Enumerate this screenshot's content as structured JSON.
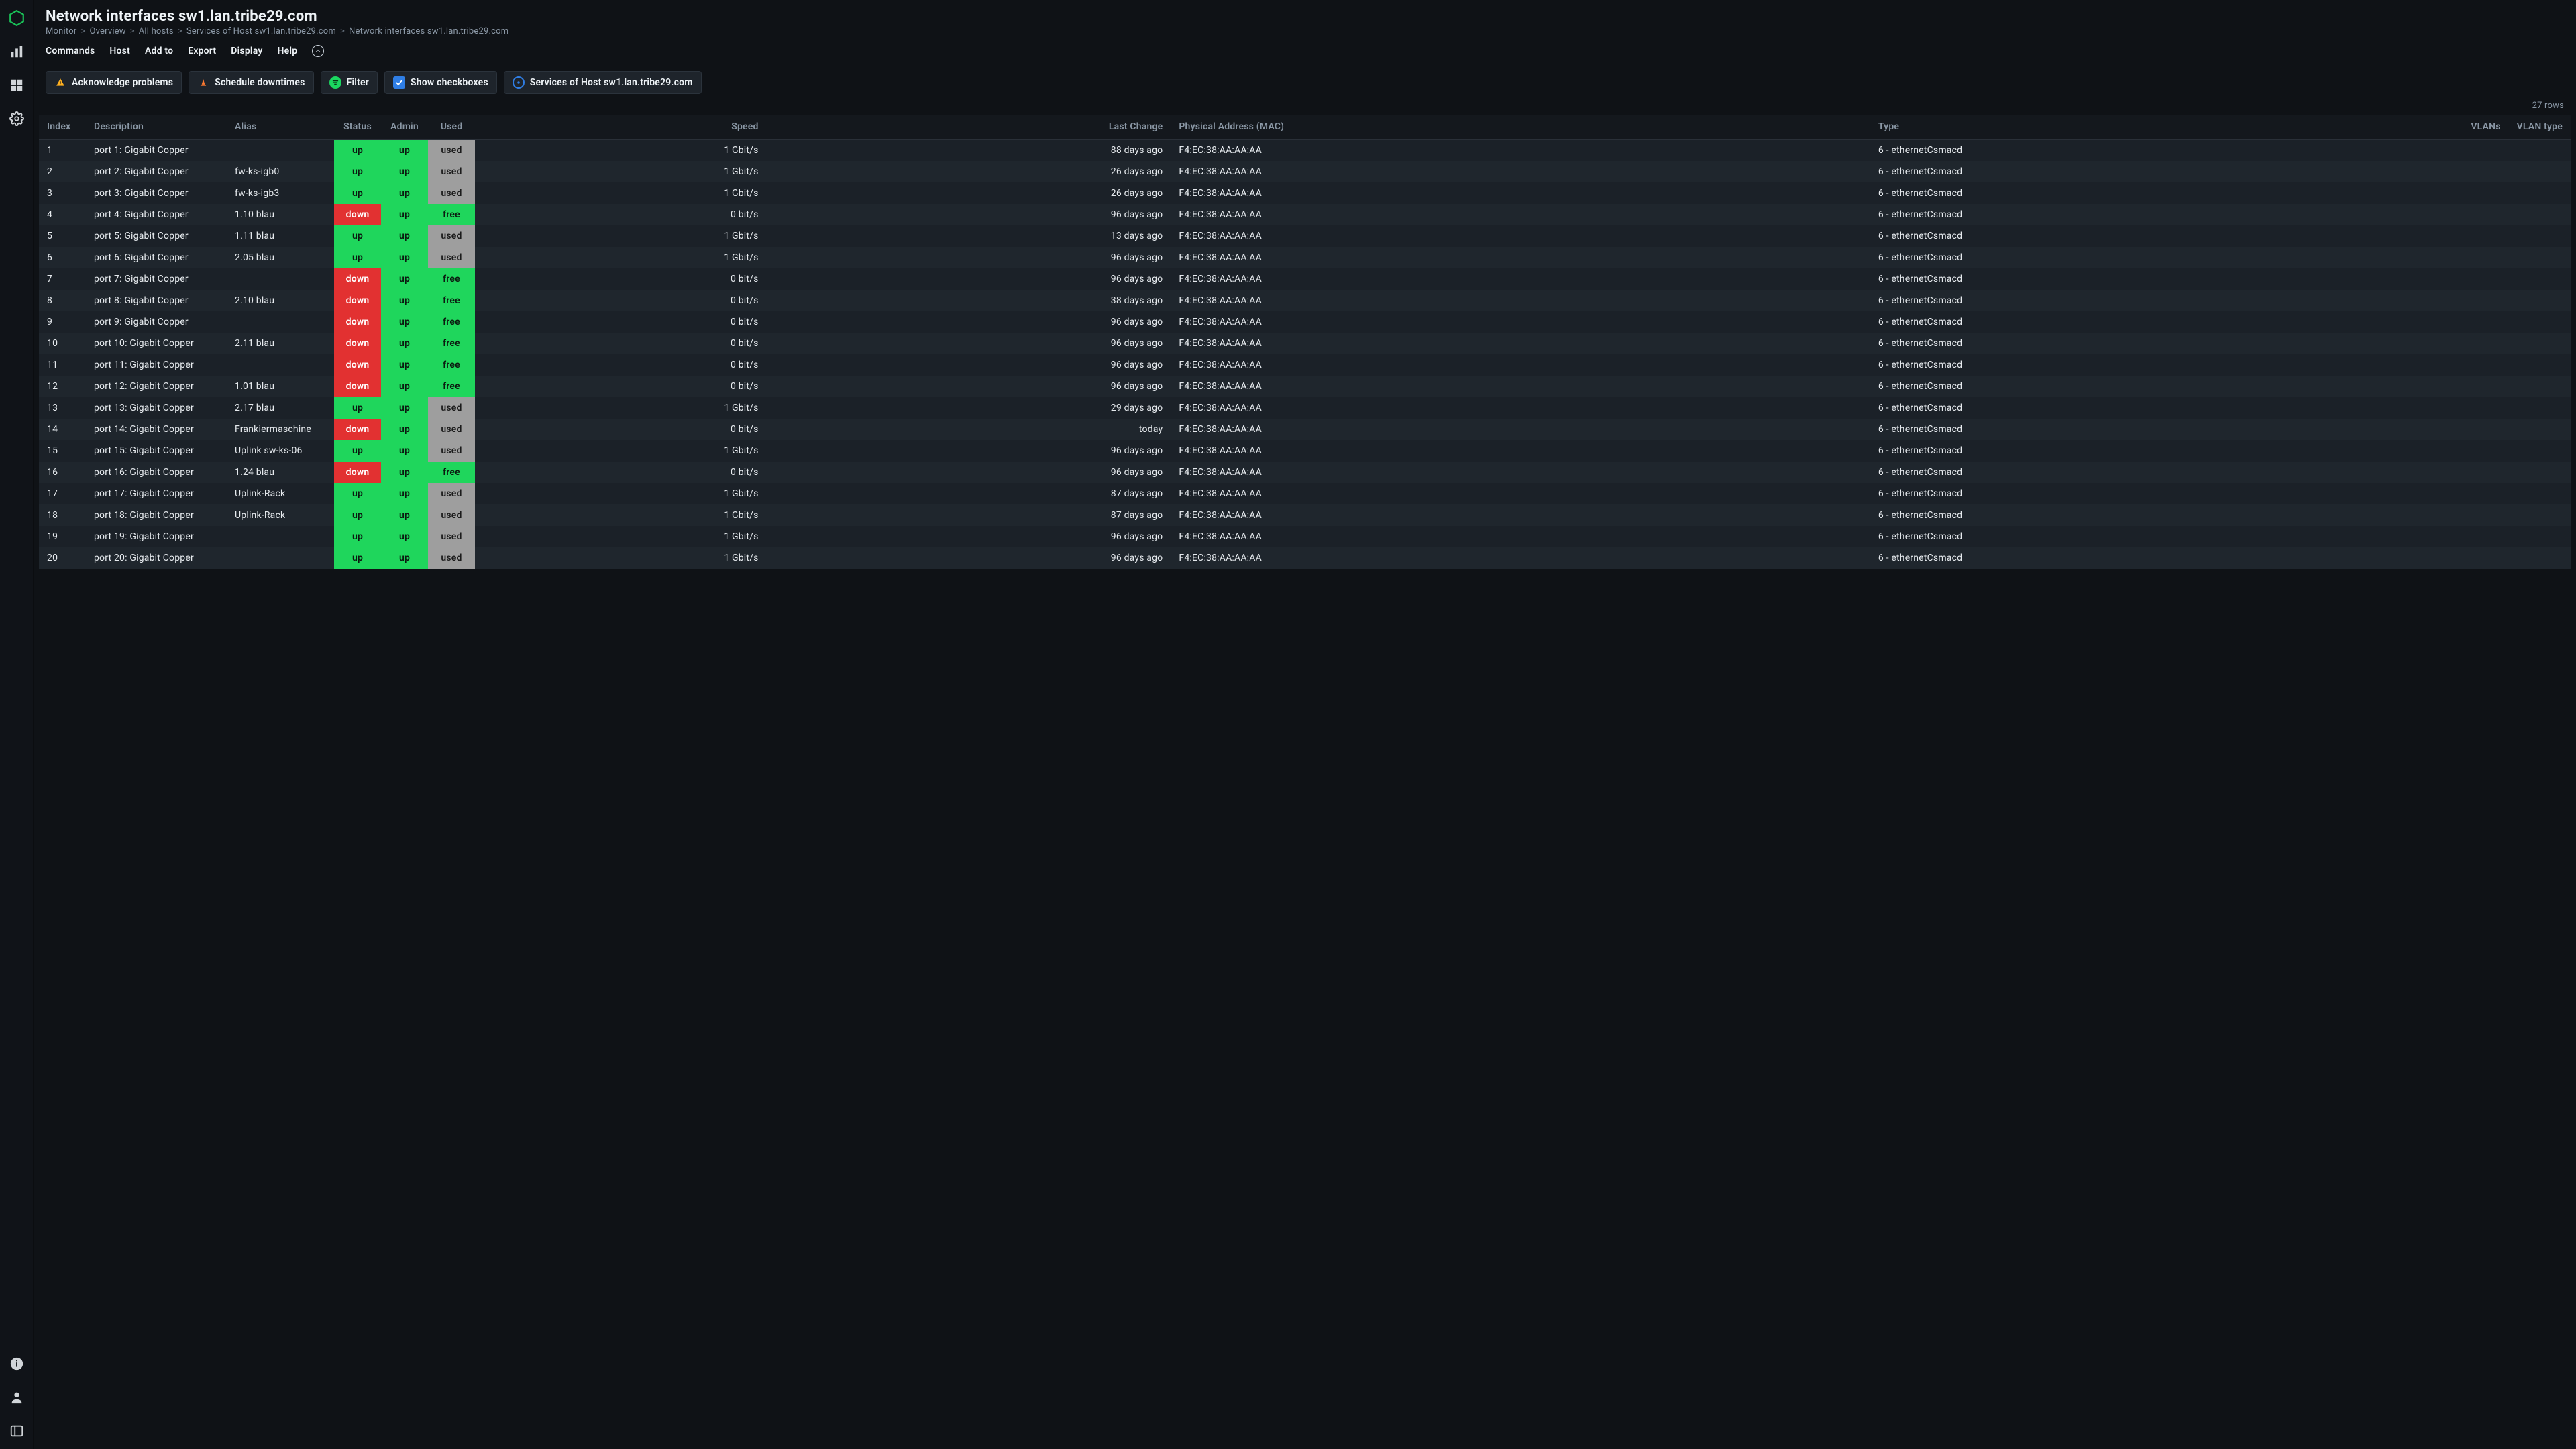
{
  "page": {
    "title": "Network interfaces sw1.lan.tribe29.com",
    "rows_label": "27 rows"
  },
  "breadcrumb": [
    "Monitor",
    "Overview",
    "All hosts",
    "Services of Host sw1.lan.tribe29.com",
    "Network interfaces sw1.lan.tribe29.com"
  ],
  "menubar": [
    "Commands",
    "Host",
    "Add to",
    "Export",
    "Display",
    "Help"
  ],
  "toolbar": {
    "ack": "Acknowledge problems",
    "downtime": "Schedule downtimes",
    "filter": "Filter",
    "checkboxes": "Show checkboxes",
    "services": "Services of Host sw1.lan.tribe29.com"
  },
  "columns": {
    "index": "Index",
    "description": "Description",
    "alias": "Alias",
    "status": "Status",
    "admin": "Admin",
    "used": "Used",
    "speed": "Speed",
    "last": "Last Change",
    "mac": "Physical Address (MAC)",
    "type": "Type",
    "vlans": "VLANs",
    "vtype": "VLAN type"
  },
  "rows": [
    {
      "index": "1",
      "desc": "port 1: Gigabit Copper",
      "alias": "",
      "status": "up",
      "admin": "up",
      "used": "used",
      "speed": "1 Gbit/s",
      "last": "88 days ago",
      "mac": "F4:EC:38:AA:AA:AA",
      "type": "6 - ethernetCsmacd",
      "vlans": "",
      "vtype": ""
    },
    {
      "index": "2",
      "desc": "port 2: Gigabit Copper",
      "alias": "fw-ks-igb0",
      "status": "up",
      "admin": "up",
      "used": "used",
      "speed": "1 Gbit/s",
      "last": "26 days ago",
      "mac": "F4:EC:38:AA:AA:AA",
      "type": "6 - ethernetCsmacd",
      "vlans": "",
      "vtype": ""
    },
    {
      "index": "3",
      "desc": "port 3: Gigabit Copper",
      "alias": "fw-ks-igb3",
      "status": "up",
      "admin": "up",
      "used": "used",
      "speed": "1 Gbit/s",
      "last": "26 days ago",
      "mac": "F4:EC:38:AA:AA:AA",
      "type": "6 - ethernetCsmacd",
      "vlans": "",
      "vtype": ""
    },
    {
      "index": "4",
      "desc": "port 4: Gigabit Copper",
      "alias": "1.10 blau",
      "status": "down",
      "admin": "up",
      "used": "free",
      "speed": "0 bit/s",
      "last": "96 days ago",
      "mac": "F4:EC:38:AA:AA:AA",
      "type": "6 - ethernetCsmacd",
      "vlans": "",
      "vtype": ""
    },
    {
      "index": "5",
      "desc": "port 5: Gigabit Copper",
      "alias": "1.11 blau",
      "status": "up",
      "admin": "up",
      "used": "used",
      "speed": "1 Gbit/s",
      "last": "13 days ago",
      "mac": "F4:EC:38:AA:AA:AA",
      "type": "6 - ethernetCsmacd",
      "vlans": "",
      "vtype": ""
    },
    {
      "index": "6",
      "desc": "port 6: Gigabit Copper",
      "alias": "2.05 blau",
      "status": "up",
      "admin": "up",
      "used": "used",
      "speed": "1 Gbit/s",
      "last": "96 days ago",
      "mac": "F4:EC:38:AA:AA:AA",
      "type": "6 - ethernetCsmacd",
      "vlans": "",
      "vtype": ""
    },
    {
      "index": "7",
      "desc": "port 7: Gigabit Copper",
      "alias": "",
      "status": "down",
      "admin": "up",
      "used": "free",
      "speed": "0 bit/s",
      "last": "96 days ago",
      "mac": "F4:EC:38:AA:AA:AA",
      "type": "6 - ethernetCsmacd",
      "vlans": "",
      "vtype": ""
    },
    {
      "index": "8",
      "desc": "port 8: Gigabit Copper",
      "alias": "2.10 blau",
      "status": "down",
      "admin": "up",
      "used": "free",
      "speed": "0 bit/s",
      "last": "38 days ago",
      "mac": "F4:EC:38:AA:AA:AA",
      "type": "6 - ethernetCsmacd",
      "vlans": "",
      "vtype": ""
    },
    {
      "index": "9",
      "desc": "port 9: Gigabit Copper",
      "alias": "",
      "status": "down",
      "admin": "up",
      "used": "free",
      "speed": "0 bit/s",
      "last": "96 days ago",
      "mac": "F4:EC:38:AA:AA:AA",
      "type": "6 - ethernetCsmacd",
      "vlans": "",
      "vtype": ""
    },
    {
      "index": "10",
      "desc": "port 10: Gigabit Copper",
      "alias": "2.11 blau",
      "status": "down",
      "admin": "up",
      "used": "free",
      "speed": "0 bit/s",
      "last": "96 days ago",
      "mac": "F4:EC:38:AA:AA:AA",
      "type": "6 - ethernetCsmacd",
      "vlans": "",
      "vtype": ""
    },
    {
      "index": "11",
      "desc": "port 11: Gigabit Copper",
      "alias": "",
      "status": "down",
      "admin": "up",
      "used": "free",
      "speed": "0 bit/s",
      "last": "96 days ago",
      "mac": "F4:EC:38:AA:AA:AA",
      "type": "6 - ethernetCsmacd",
      "vlans": "",
      "vtype": ""
    },
    {
      "index": "12",
      "desc": "port 12: Gigabit Copper",
      "alias": "1.01 blau",
      "status": "down",
      "admin": "up",
      "used": "free",
      "speed": "0 bit/s",
      "last": "96 days ago",
      "mac": "F4:EC:38:AA:AA:AA",
      "type": "6 - ethernetCsmacd",
      "vlans": "",
      "vtype": ""
    },
    {
      "index": "13",
      "desc": "port 13: Gigabit Copper",
      "alias": "2.17 blau",
      "status": "up",
      "admin": "up",
      "used": "used",
      "speed": "1 Gbit/s",
      "last": "29 days ago",
      "mac": "F4:EC:38:AA:AA:AA",
      "type": "6 - ethernetCsmacd",
      "vlans": "",
      "vtype": ""
    },
    {
      "index": "14",
      "desc": "port 14: Gigabit Copper",
      "alias": "Frankiermaschine",
      "status": "down",
      "admin": "up",
      "used": "used",
      "speed": "0 bit/s",
      "last": "today",
      "mac": "F4:EC:38:AA:AA:AA",
      "type": "6 - ethernetCsmacd",
      "vlans": "",
      "vtype": ""
    },
    {
      "index": "15",
      "desc": "port 15: Gigabit Copper",
      "alias": "Uplink sw-ks-06",
      "status": "up",
      "admin": "up",
      "used": "used",
      "speed": "1 Gbit/s",
      "last": "96 days ago",
      "mac": "F4:EC:38:AA:AA:AA",
      "type": "6 - ethernetCsmacd",
      "vlans": "",
      "vtype": ""
    },
    {
      "index": "16",
      "desc": "port 16: Gigabit Copper",
      "alias": "1.24 blau",
      "status": "down",
      "admin": "up",
      "used": "free",
      "speed": "0 bit/s",
      "last": "96 days ago",
      "mac": "F4:EC:38:AA:AA:AA",
      "type": "6 - ethernetCsmacd",
      "vlans": "",
      "vtype": ""
    },
    {
      "index": "17",
      "desc": "port 17: Gigabit Copper",
      "alias": "Uplink-Rack",
      "status": "up",
      "admin": "up",
      "used": "used",
      "speed": "1 Gbit/s",
      "last": "87 days ago",
      "mac": "F4:EC:38:AA:AA:AA",
      "type": "6 - ethernetCsmacd",
      "vlans": "",
      "vtype": ""
    },
    {
      "index": "18",
      "desc": "port 18: Gigabit Copper",
      "alias": "Uplink-Rack",
      "status": "up",
      "admin": "up",
      "used": "used",
      "speed": "1 Gbit/s",
      "last": "87 days ago",
      "mac": "F4:EC:38:AA:AA:AA",
      "type": "6 - ethernetCsmacd",
      "vlans": "",
      "vtype": ""
    },
    {
      "index": "19",
      "desc": "port 19: Gigabit Copper",
      "alias": "",
      "status": "up",
      "admin": "up",
      "used": "used",
      "speed": "1 Gbit/s",
      "last": "96 days ago",
      "mac": "F4:EC:38:AA:AA:AA",
      "type": "6 - ethernetCsmacd",
      "vlans": "",
      "vtype": ""
    },
    {
      "index": "20",
      "desc": "port 20: Gigabit Copper",
      "alias": "",
      "status": "up",
      "admin": "up",
      "used": "used",
      "speed": "1 Gbit/s",
      "last": "96 days ago",
      "mac": "F4:EC:38:AA:AA:AA",
      "type": "6 - ethernetCsmacd",
      "vlans": "",
      "vtype": ""
    }
  ]
}
